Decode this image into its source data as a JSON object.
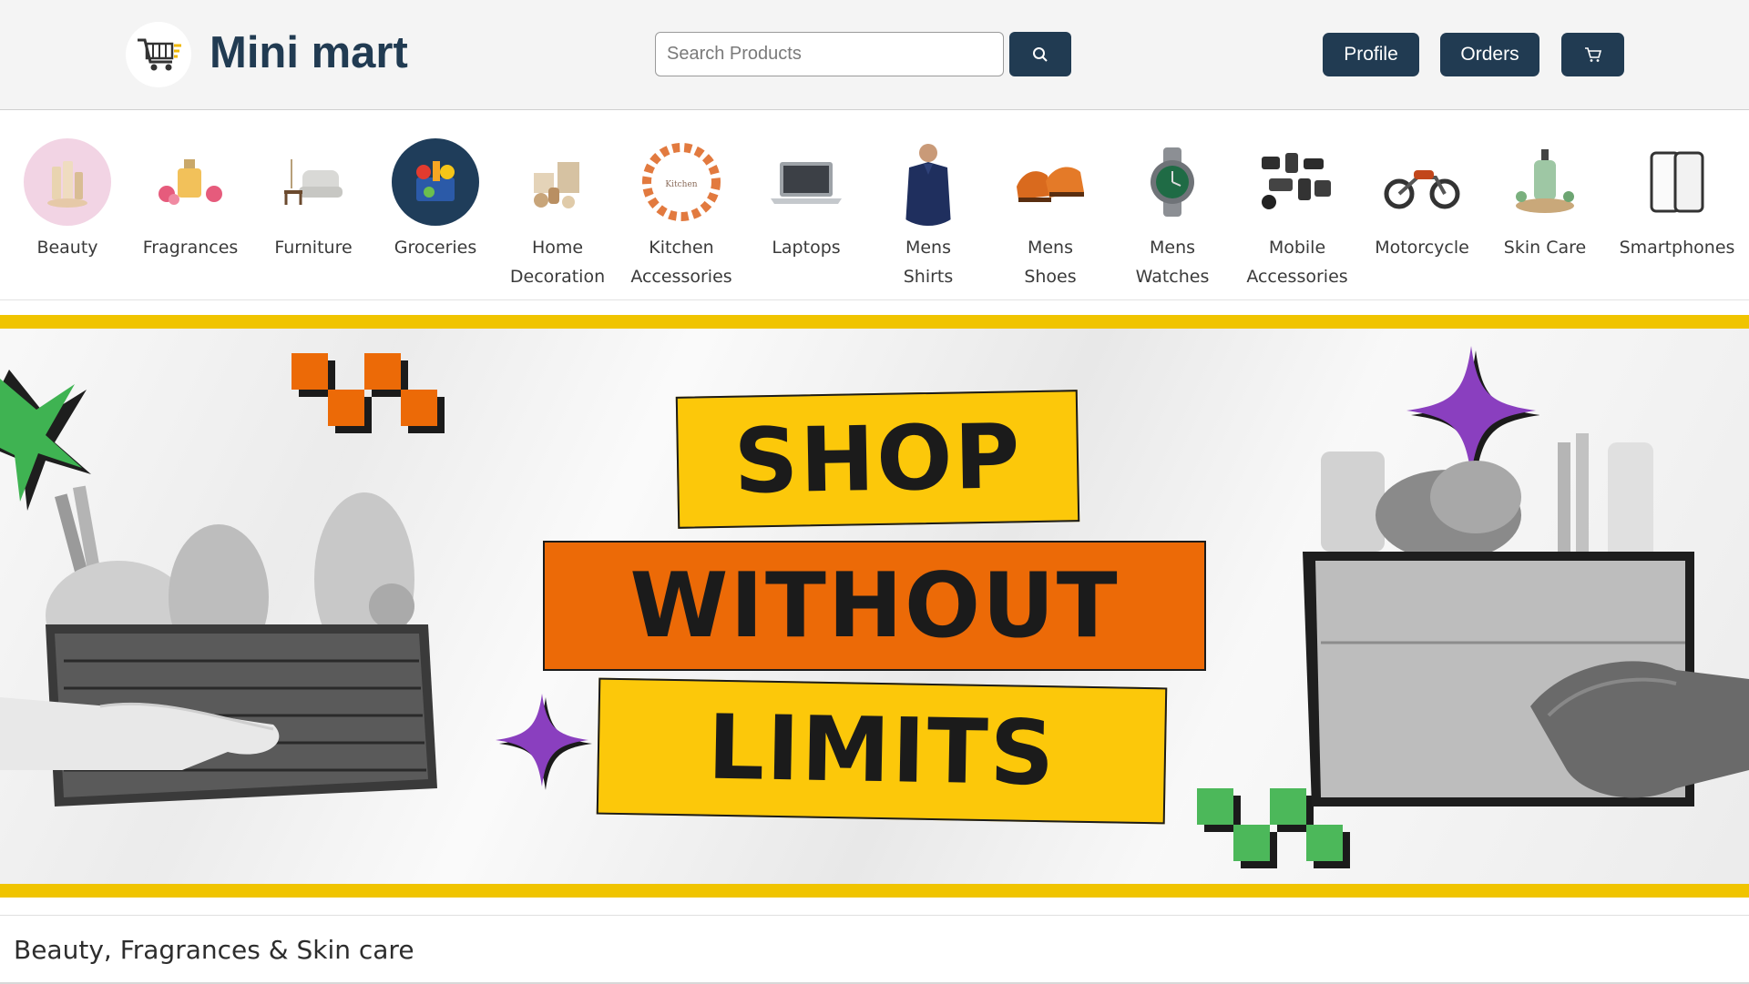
{
  "header": {
    "brand": "Mini mart",
    "search_placeholder": "Search Products",
    "profile_label": "Profile",
    "orders_label": "Orders",
    "accent_color": "#213b52"
  },
  "categories": [
    {
      "label": "Beauty",
      "icon": "beauty-icon"
    },
    {
      "label": "Fragrances",
      "icon": "fragrance-icon"
    },
    {
      "label": "Furniture",
      "icon": "furniture-icon"
    },
    {
      "label": "Groceries",
      "icon": "groceries-icon"
    },
    {
      "label": "Home\nDecoration",
      "icon": "home-decoration-icon"
    },
    {
      "label": "Kitchen\nAccessories",
      "icon": "kitchen-icon"
    },
    {
      "label": "Laptops",
      "icon": "laptop-icon"
    },
    {
      "label": "Mens\nShirts",
      "icon": "shirt-icon"
    },
    {
      "label": "Mens\nShoes",
      "icon": "shoes-icon"
    },
    {
      "label": "Mens\nWatches",
      "icon": "watch-icon"
    },
    {
      "label": "Mobile\nAccessories",
      "icon": "mobile-accessories-icon"
    },
    {
      "label": "Motorcycle",
      "icon": "motorcycle-icon"
    },
    {
      "label": "Skin Care",
      "icon": "skin-care-icon"
    },
    {
      "label": "Smartphones",
      "icon": "smartphone-icon"
    }
  ],
  "banner": {
    "line1": "SHOP",
    "line2": "WITHOUT",
    "line3": "LIMITS",
    "colors": {
      "yellow": "#fcc80a",
      "orange": "#ec6a07",
      "purple": "#8a3fbf",
      "green": "#4cb85a"
    }
  },
  "section": {
    "title": "Beauty, Fragrances & Skin care"
  }
}
